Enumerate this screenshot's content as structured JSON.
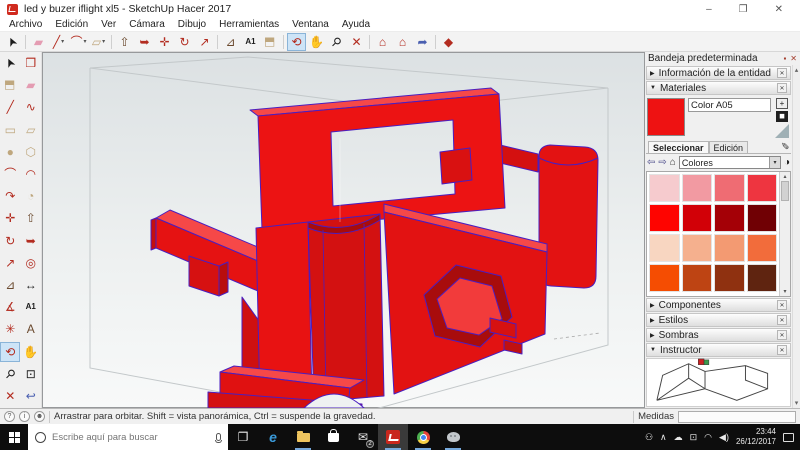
{
  "window": {
    "title": "led y buzer iflight xl5 - SketchUp Hacer 2017",
    "controls": {
      "minimize": "–",
      "maximize": "❐",
      "close": "✕"
    }
  },
  "menu": {
    "items": [
      "Archivo",
      "Edición",
      "Ver",
      "Cámara",
      "Dibujo",
      "Herramientas",
      "Ventana",
      "Ayuda"
    ]
  },
  "toolbar": {
    "items": [
      {
        "name": "select",
        "glyph": "➤"
      },
      {
        "name": "eraser",
        "glyph": "▰"
      },
      {
        "name": "line",
        "glyph": "╱"
      },
      {
        "name": "arc",
        "glyph": "⌒"
      },
      {
        "name": "rectangle",
        "glyph": "▱"
      },
      {
        "name": "push-pull",
        "glyph": "⇧"
      },
      {
        "name": "follow-me",
        "glyph": "➥"
      },
      {
        "name": "move",
        "glyph": "✛"
      },
      {
        "name": "rotate",
        "glyph": "↻"
      },
      {
        "name": "scale",
        "glyph": "↗"
      },
      {
        "name": "tape-measure",
        "glyph": "⊿"
      },
      {
        "name": "text",
        "glyph": "A1"
      },
      {
        "name": "paint-bucket",
        "glyph": "◧"
      },
      {
        "name": "orbit",
        "glyph": "⟲",
        "active": true
      },
      {
        "name": "pan",
        "glyph": "✋"
      },
      {
        "name": "zoom",
        "glyph": "⚲"
      },
      {
        "name": "zoom-extents",
        "glyph": "✕"
      },
      {
        "name": "warehouse-3d",
        "glyph": "⌂"
      },
      {
        "name": "warehouse-extension",
        "glyph": "⌂"
      },
      {
        "name": "share-model",
        "glyph": "➦"
      },
      {
        "name": "extension-gem",
        "glyph": "◆"
      }
    ]
  },
  "left_toolbar": {
    "items": [
      {
        "name": "select",
        "glyph": "➤"
      },
      {
        "name": "make-component",
        "glyph": "❒"
      },
      {
        "name": "paint-bucket",
        "glyph": "◧"
      },
      {
        "name": "eraser",
        "glyph": "▰"
      },
      {
        "name": "line",
        "glyph": "╱"
      },
      {
        "name": "freehand",
        "glyph": "∿"
      },
      {
        "name": "rectangle",
        "glyph": "▭"
      },
      {
        "name": "rotated-rectangle",
        "glyph": "▱"
      },
      {
        "name": "circle",
        "glyph": "●"
      },
      {
        "name": "polygon",
        "glyph": "⬡"
      },
      {
        "name": "arc",
        "glyph": "⌒"
      },
      {
        "name": "two-point-arc",
        "glyph": "◠"
      },
      {
        "name": "three-point-arc",
        "glyph": "↷"
      },
      {
        "name": "pie",
        "glyph": "◔"
      },
      {
        "name": "move",
        "glyph": "✛"
      },
      {
        "name": "push-pull",
        "glyph": "⇧"
      },
      {
        "name": "rotate",
        "glyph": "↻"
      },
      {
        "name": "follow-me",
        "glyph": "➥"
      },
      {
        "name": "scale",
        "glyph": "↗"
      },
      {
        "name": "offset",
        "glyph": "◎"
      },
      {
        "name": "tape-measure",
        "glyph": "⊿"
      },
      {
        "name": "dimensions",
        "glyph": "↔"
      },
      {
        "name": "protractor",
        "glyph": "∡"
      },
      {
        "name": "text",
        "glyph": "A1"
      },
      {
        "name": "axes",
        "glyph": "✳"
      },
      {
        "name": "3d-text",
        "glyph": "A"
      },
      {
        "name": "orbit",
        "glyph": "⟲",
        "active": true
      },
      {
        "name": "pan",
        "glyph": "✋"
      },
      {
        "name": "zoom",
        "glyph": "⚲"
      },
      {
        "name": "zoom-window",
        "glyph": "⊡"
      },
      {
        "name": "zoom-extents",
        "glyph": "✕"
      },
      {
        "name": "zoom-previous",
        "glyph": "↩"
      }
    ]
  },
  "tray": {
    "title": "Bandeja predeterminada",
    "sections": [
      {
        "label": "Información de la entidad",
        "arrow": "▶"
      },
      {
        "label": "Materiales",
        "arrow": "▼"
      },
      {
        "label": "Componentes",
        "arrow": "▶"
      },
      {
        "label": "Estilos",
        "arrow": "▶"
      },
      {
        "label": "Sombras",
        "arrow": "▶"
      },
      {
        "label": "Instructor",
        "arrow": "▼"
      }
    ],
    "materials": {
      "name": "Color A05",
      "color": "#ee1212",
      "tabs": [
        "Seleccionar",
        "Edición"
      ],
      "collection": "Colores",
      "swatches": [
        "#f6cbce",
        "#f29aa2",
        "#ef6c73",
        "#ee3540",
        "#fe0400",
        "#d20007",
        "#a40006",
        "#700004",
        "#f8d6c1",
        "#f5b08e",
        "#f39a72",
        "#f26c3b",
        "#f54d02",
        "#be4413",
        "#8f3110",
        "#5f2410"
      ]
    }
  },
  "ui": {
    "dropdown": "▾",
    "up": "▴",
    "down": "▾",
    "close": "✕",
    "pin": "▪",
    "back": "⇦",
    "forward": "⇨",
    "home": "⌂",
    "eyedropper": "✎",
    "sample": "◑",
    "plus": "+",
    "help": "?",
    "info": "i",
    "person": "☻"
  },
  "viewport": {
    "model_color": "#ec1313",
    "edge_color": "#4a1ec0",
    "shade_color": "#c90e0e",
    "highlight_color": "#f64848",
    "bbox_color": "#c3c8ca"
  },
  "statusbar": {
    "hint": "Arrastrar para orbitar. Shift = vista panorámica, Ctrl = suspende la gravedad.",
    "measure_label": "Medidas",
    "measure_value": ""
  },
  "taskbar": {
    "search_placeholder": "Escribe aquí para buscar",
    "edge_letter": "e",
    "icons": {
      "task_view": "❐",
      "mail": "✉",
      "people": "⚇",
      "chevron_up": "∧",
      "cloud": "☁",
      "monitor": "⊡",
      "wifi": "◠",
      "speaker": "◀)"
    },
    "mail_badge": "2",
    "clock": {
      "time": "23:44",
      "date": "26/12/2017"
    }
  }
}
